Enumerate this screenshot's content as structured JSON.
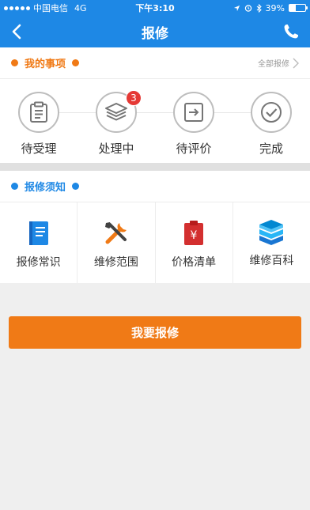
{
  "status_bar": {
    "carrier": "中国电信",
    "network": "4G",
    "time": "下午3:10",
    "battery": "39%",
    "battery_level": 0.39
  },
  "nav": {
    "title": "报修",
    "back_icon": "chevron-left-icon",
    "phone_icon": "phone-icon"
  },
  "my_items": {
    "title": "我的事项",
    "all_link": "全部报修",
    "accent": "#f07a16",
    "steps": [
      {
        "label": "待受理",
        "icon": "clipboard-icon",
        "badge": null
      },
      {
        "label": "处理中",
        "icon": "layers-icon",
        "badge": "3"
      },
      {
        "label": "待评价",
        "icon": "arrow-right-box-icon",
        "badge": null
      },
      {
        "label": "完成",
        "icon": "check-circle-icon",
        "badge": null
      }
    ]
  },
  "notice": {
    "title": "报修须知",
    "accent": "#1e88e5",
    "items": [
      {
        "label": "报修常识",
        "icon": "book-icon"
      },
      {
        "label": "维修范围",
        "icon": "tools-icon"
      },
      {
        "label": "价格清单",
        "icon": "price-tag-icon"
      },
      {
        "label": "维修百科",
        "icon": "books-stack-icon"
      }
    ]
  },
  "submit": {
    "label": "我要报修",
    "color": "#f07a16"
  },
  "colors": {
    "primary": "#1e88e5",
    "accent": "#f07a16",
    "badge": "#e53935"
  }
}
